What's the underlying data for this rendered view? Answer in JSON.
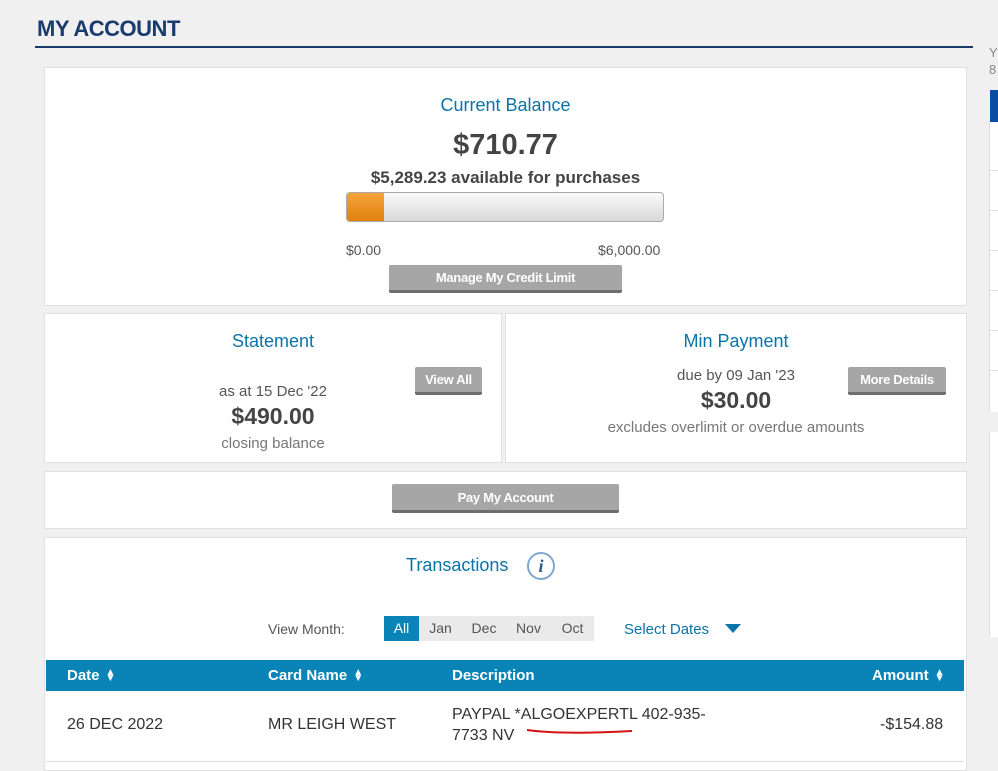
{
  "page": {
    "title": "MY ACCOUNT"
  },
  "sidebar_fragments": {
    "line1": "Y",
    "line2": "8"
  },
  "balance": {
    "title": "Current Balance",
    "amount": "$710.77",
    "available": "$5,289.23 available for purchases",
    "bar_min_label": "$0.00",
    "bar_max_label": "$6,000.00",
    "used_fraction": 0.118,
    "button_label": "Manage My Credit Limit"
  },
  "statement": {
    "title": "Statement",
    "as_at": "as at 15 Dec '22",
    "amount": "$490.00",
    "subtext": "closing balance",
    "button_label": "View All"
  },
  "min_payment": {
    "title": "Min Payment",
    "due": "due by 09 Jan '23",
    "amount": "$30.00",
    "subtext": "excludes overlimit or overdue amounts",
    "button_label": "More Details"
  },
  "pay": {
    "button_label": "Pay My Account"
  },
  "transactions": {
    "title": "Transactions",
    "info_icon": "info-icon",
    "view_month_label": "View Month:",
    "months": [
      "All",
      "Jan",
      "Dec",
      "Nov",
      "Oct"
    ],
    "active_month": "All",
    "select_dates_label": "Select Dates",
    "columns": {
      "date": "Date",
      "card_name": "Card Name",
      "description": "Description",
      "amount": "Amount"
    },
    "rows": [
      {
        "date": "26 DEC 2022",
        "card_name": "MR LEIGH WEST",
        "description_line1": "PAYPAL *ALGOEXPERTL 402-935-",
        "description_line2": "7733 NV",
        "amount": "-$154.88"
      }
    ]
  },
  "colors": {
    "accent": "#0a84b7",
    "title_blue": "#1a3b6e",
    "bar_fill": "#f09a2a"
  }
}
